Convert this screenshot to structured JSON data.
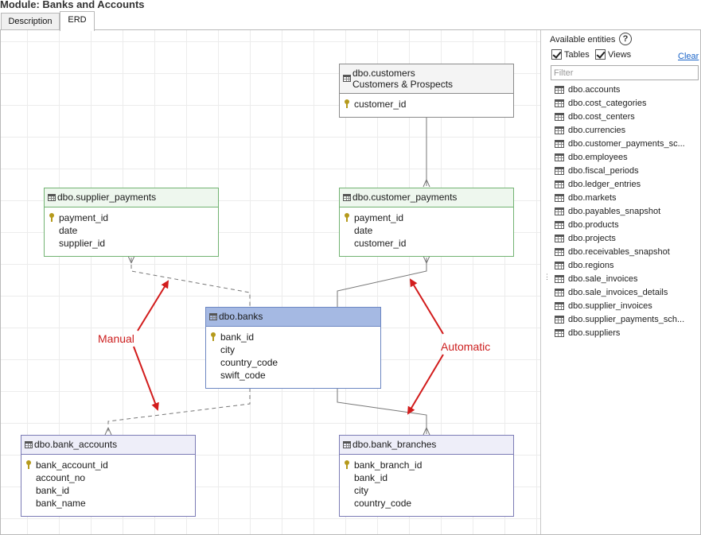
{
  "module_title": "Module: Banks and Accounts",
  "tabs": [
    {
      "label": "Description",
      "active": false
    },
    {
      "label": "ERD",
      "active": true
    }
  ],
  "erd": {
    "entities": {
      "customers": {
        "name": "dbo.customers",
        "subtitle": "Customers & Prospects",
        "columns": [
          {
            "name": "customer_id",
            "key": true
          }
        ]
      },
      "supplier_payments": {
        "name": "dbo.supplier_payments",
        "columns": [
          {
            "name": "payment_id",
            "key": true
          },
          {
            "name": "date",
            "key": false
          },
          {
            "name": "supplier_id",
            "key": false
          }
        ]
      },
      "customer_payments": {
        "name": "dbo.customer_payments",
        "columns": [
          {
            "name": "payment_id",
            "key": true
          },
          {
            "name": "date",
            "key": false
          },
          {
            "name": "customer_id",
            "key": false
          }
        ]
      },
      "banks": {
        "name": "dbo.banks",
        "columns": [
          {
            "name": "bank_id",
            "key": true
          },
          {
            "name": "city",
            "key": false
          },
          {
            "name": "country_code",
            "key": false
          },
          {
            "name": "swift_code",
            "key": false
          }
        ]
      },
      "bank_accounts": {
        "name": "dbo.bank_accounts",
        "columns": [
          {
            "name": "bank_account_id",
            "key": true
          },
          {
            "name": "account_no",
            "key": false
          },
          {
            "name": "bank_id",
            "key": false
          },
          {
            "name": "bank_name",
            "key": false
          }
        ]
      },
      "bank_branches": {
        "name": "dbo.bank_branches",
        "columns": [
          {
            "name": "bank_branch_id",
            "key": true
          },
          {
            "name": "bank_id",
            "key": false
          },
          {
            "name": "city",
            "key": false
          },
          {
            "name": "country_code",
            "key": false
          }
        ]
      }
    },
    "annotations": {
      "manual": "Manual",
      "automatic": "Automatic"
    },
    "colors": {
      "annotation": "#cc1d1d",
      "banks_header": "#a5b9e3",
      "payments_header": "#eef7ee",
      "bank_detail_header": "#eeeef9"
    }
  },
  "sidebar": {
    "title": "Available entities",
    "help_icon": "question-icon",
    "filters": {
      "tables_label": "Tables",
      "tables_checked": true,
      "views_label": "Views",
      "views_checked": true
    },
    "clear_label": "Clear",
    "filter_placeholder": "Filter",
    "filter_value": "",
    "entities": [
      "dbo.accounts",
      "dbo.cost_categories",
      "dbo.cost_centers",
      "dbo.currencies",
      "dbo.customer_payments_sc...",
      "dbo.employees",
      "dbo.fiscal_periods",
      "dbo.ledger_entries",
      "dbo.markets",
      "dbo.payables_snapshot",
      "dbo.products",
      "dbo.projects",
      "dbo.receivables_snapshot",
      "dbo.regions",
      "dbo.sale_invoices",
      "dbo.sale_invoices_details",
      "dbo.supplier_invoices",
      "dbo.supplier_payments_sch...",
      "dbo.suppliers"
    ]
  }
}
